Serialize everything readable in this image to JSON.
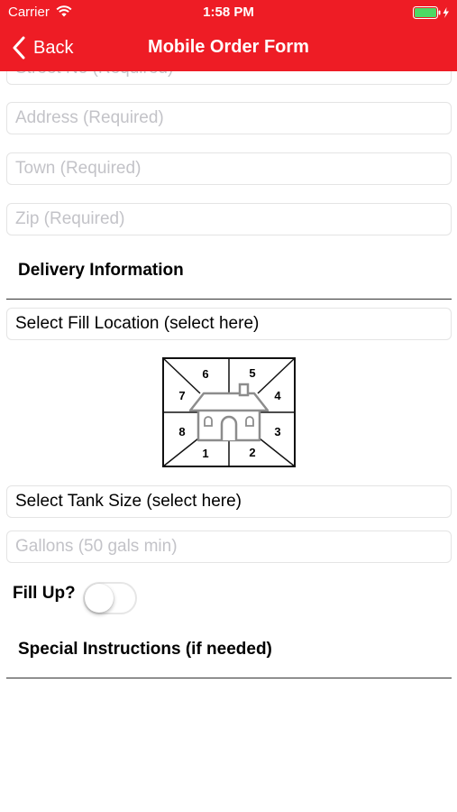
{
  "theme": {
    "accent": "#ee1c25",
    "text": "#000000",
    "placeholder": "#c3c3c8"
  },
  "status_bar": {
    "carrier": "Carrier",
    "time": "1:58 PM",
    "wifi_icon": "wifi-icon",
    "battery_icon": "battery-charging-icon"
  },
  "nav": {
    "back_label": "Back",
    "back_icon": "chevron-left-icon",
    "title": "Mobile Order Form"
  },
  "form": {
    "street_no": {
      "placeholder": "Street No (Required)",
      "value": ""
    },
    "address": {
      "placeholder": "Address (Required)",
      "value": ""
    },
    "town": {
      "placeholder": "Town (Required)",
      "value": ""
    },
    "zip": {
      "placeholder": "Zip (Required)",
      "value": ""
    },
    "delivery_heading": "Delivery Information",
    "fill_location_label": "Select Fill Location (select here)",
    "location_diagram": {
      "icon": "house-icon",
      "zones": [
        "1",
        "2",
        "3",
        "4",
        "5",
        "6",
        "7",
        "8"
      ]
    },
    "tank_size_label": "Select Tank Size (select here)",
    "gallons": {
      "placeholder": "Gallons (50 gals min)",
      "value": ""
    },
    "fill_up_label": "Fill Up?",
    "fill_up_on": false,
    "special_instructions_heading": "Special Instructions (if needed)"
  }
}
